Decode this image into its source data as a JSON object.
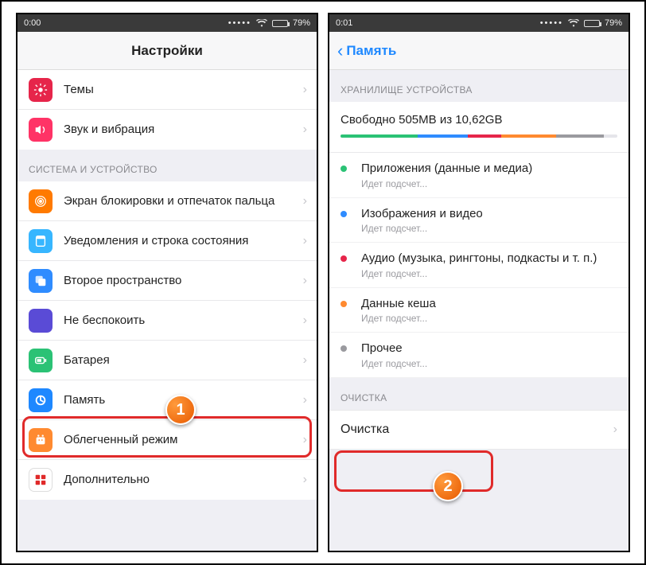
{
  "left": {
    "status": {
      "time": "0:00",
      "battery": "79%"
    },
    "header": {
      "title": "Настройки"
    },
    "group1": [
      {
        "label": "Темы"
      },
      {
        "label": "Звук и вибрация"
      }
    ],
    "section_system": "СИСТЕМА И УСТРОЙСТВО",
    "group2": [
      {
        "label": "Экран блокировки и отпечаток пальца"
      },
      {
        "label": "Уведомления и строка состояния"
      },
      {
        "label": "Второе пространство"
      },
      {
        "label": "Не беспокоить"
      },
      {
        "label": "Батарея"
      },
      {
        "label": "Память"
      },
      {
        "label": "Облегченный режим"
      },
      {
        "label": "Дополнительно"
      }
    ]
  },
  "right": {
    "status": {
      "time": "0:01",
      "battery": "79%"
    },
    "header": {
      "back": "Память"
    },
    "section_storage": "ХРАНИЛИЩЕ УСТРОЙСТВА",
    "summary": "Свободно 505MB из 10,62GB",
    "progress_segments": [
      {
        "color": "#2bc275",
        "pct": 28
      },
      {
        "color": "#2f8cff",
        "pct": 18
      },
      {
        "color": "#e6254a",
        "pct": 12
      },
      {
        "color": "#ff8a30",
        "pct": 20
      },
      {
        "color": "#9a9a9f",
        "pct": 17
      }
    ],
    "categories": [
      {
        "dot": "#2bc275",
        "name": "Приложения (данные и медиа)",
        "sub": "Идет подсчет..."
      },
      {
        "dot": "#2f8cff",
        "name": "Изображения и видео",
        "sub": "Идет подсчет..."
      },
      {
        "dot": "#e6254a",
        "name": "Аудио (музыка, рингтоны, подкасты и т. п.)",
        "sub": "Идет подсчет..."
      },
      {
        "dot": "#ff8a30",
        "name": "Данные кеша",
        "sub": "Идет подсчет..."
      },
      {
        "dot": "#9a9a9f",
        "name": "Прочее",
        "sub": "Идет подсчет..."
      }
    ],
    "section_clean": "ОЧИСТКА",
    "clean_label": "Очистка"
  },
  "callouts": {
    "one": "1",
    "two": "2"
  }
}
